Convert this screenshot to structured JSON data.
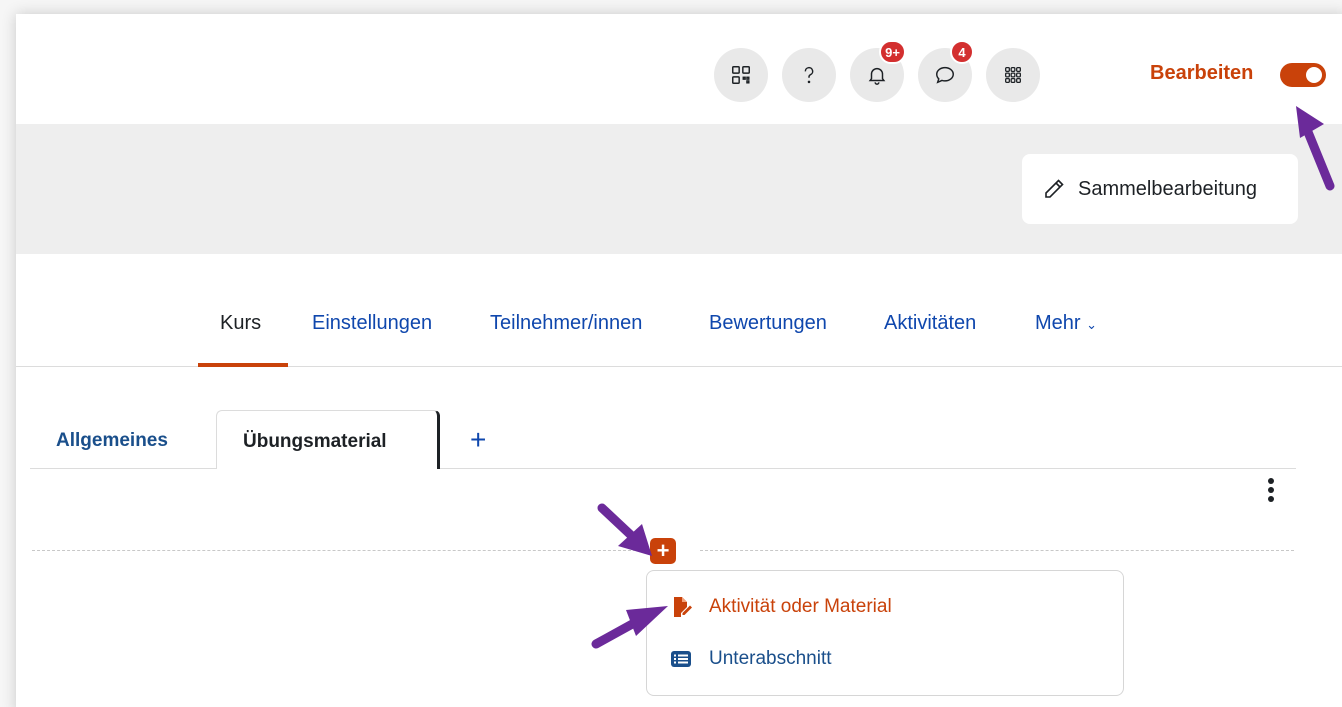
{
  "header": {
    "icons": [
      "qr-code-icon",
      "help-icon",
      "bell-icon",
      "chat-icon",
      "apps-grid-icon"
    ],
    "notifications_badge": "9+",
    "messages_badge": "4",
    "edit_label": "Bearbeiten",
    "edit_mode_on": true
  },
  "toolbar": {
    "bulk_edit_label": "Sammelbearbeitung"
  },
  "nav": {
    "items": [
      {
        "label": "Kurs",
        "active": true
      },
      {
        "label": "Einstellungen"
      },
      {
        "label": "Teilnehmer/innen"
      },
      {
        "label": "Bewertungen"
      },
      {
        "label": "Aktivitäten"
      },
      {
        "label": "Mehr"
      }
    ]
  },
  "tabs": {
    "items": [
      {
        "label": "Allgemeines"
      },
      {
        "label": "Übungsmaterial",
        "active": true
      }
    ],
    "add_label": "+"
  },
  "add_menu": {
    "add_button_label": "+",
    "items": [
      {
        "label": "Aktivität oder Material",
        "icon": "activity-edit-icon"
      },
      {
        "label": "Unterabschnitt",
        "icon": "list-icon"
      }
    ]
  },
  "colors": {
    "accent": "#c9420a",
    "link": "#0f47ad",
    "badge": "#d32f2f",
    "annotation_arrow": "#6b2a9a"
  }
}
